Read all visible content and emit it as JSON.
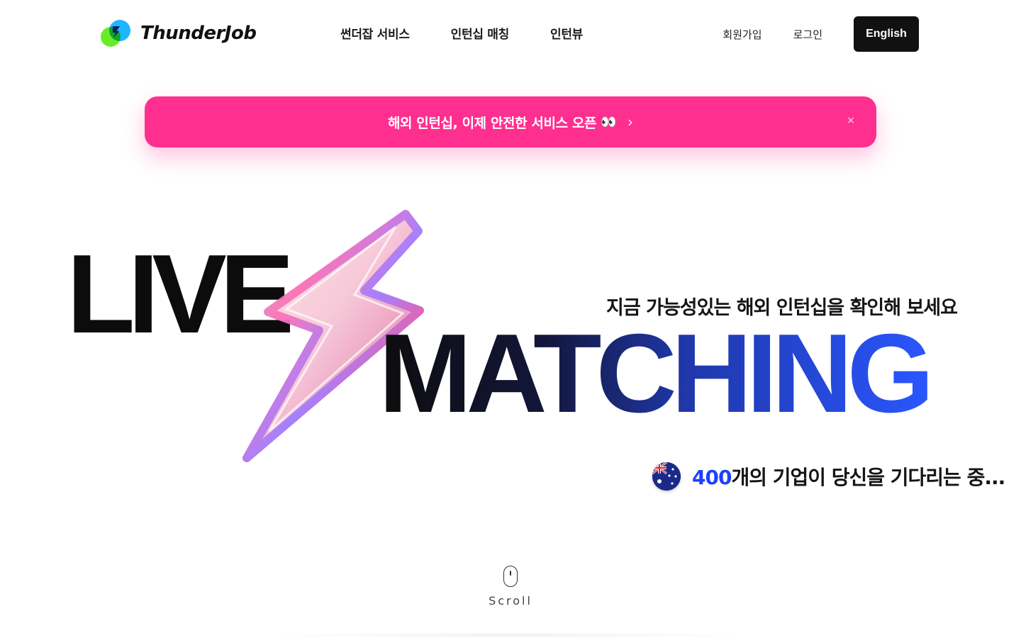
{
  "brand": {
    "name": "ThunderJob",
    "logo_icon": "thunderjob-logo-icon"
  },
  "nav": {
    "items": [
      {
        "label": "썬더잡 서비스"
      },
      {
        "label": "인턴십 매칭"
      },
      {
        "label": "인턴뷰"
      }
    ]
  },
  "auth": {
    "signup_label": "회원가입",
    "login_label": "로그인",
    "language_label": "English"
  },
  "banner": {
    "text": "해외 인턴십, 이제 안전한 서비스 오픈",
    "emoji": "👀",
    "arrow": "›",
    "close_icon": "×",
    "background": "#ff2f8f"
  },
  "hero": {
    "line1": "LIVE",
    "line2": "MATCHING",
    "subtitle": "지금 가능성있는 해외 인턴십을 확인해 보세요",
    "company_count": "400",
    "company_suffix": "개의 기업이 당신을 기다리는 중...",
    "flag_icon": "australia-flag-icon",
    "accent": "#1f3fff"
  },
  "scroll": {
    "label": "Scroll",
    "icon": "mouse-icon"
  }
}
